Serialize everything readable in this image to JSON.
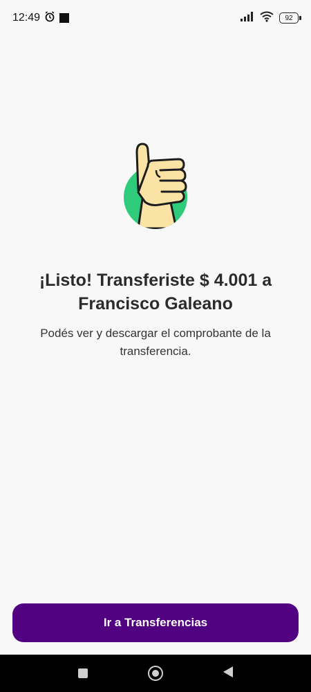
{
  "status_bar": {
    "time": "12:49",
    "battery": "92"
  },
  "main": {
    "title_line1": "¡Listo! Transferiste $ 4.001 a",
    "title_line2": "Francisco Galeano",
    "subtitle_line1": "Podés ver y descargar el comprobante de la",
    "subtitle_line2": "transferencia."
  },
  "actions": {
    "cta_label": "Ir a Transferencias"
  },
  "colors": {
    "brand_purple": "#520082",
    "illustration_green": "#2ecc7a",
    "hand_skin": "#fbe3a6"
  },
  "icons": {
    "alarm": "alarm-icon",
    "signal": "signal-icon",
    "wifi": "wifi-icon",
    "battery": "battery-icon",
    "thumbs_up": "thumbs-up-illustration",
    "nav_recents": "recents-icon",
    "nav_home": "home-icon",
    "nav_back": "back-icon"
  }
}
